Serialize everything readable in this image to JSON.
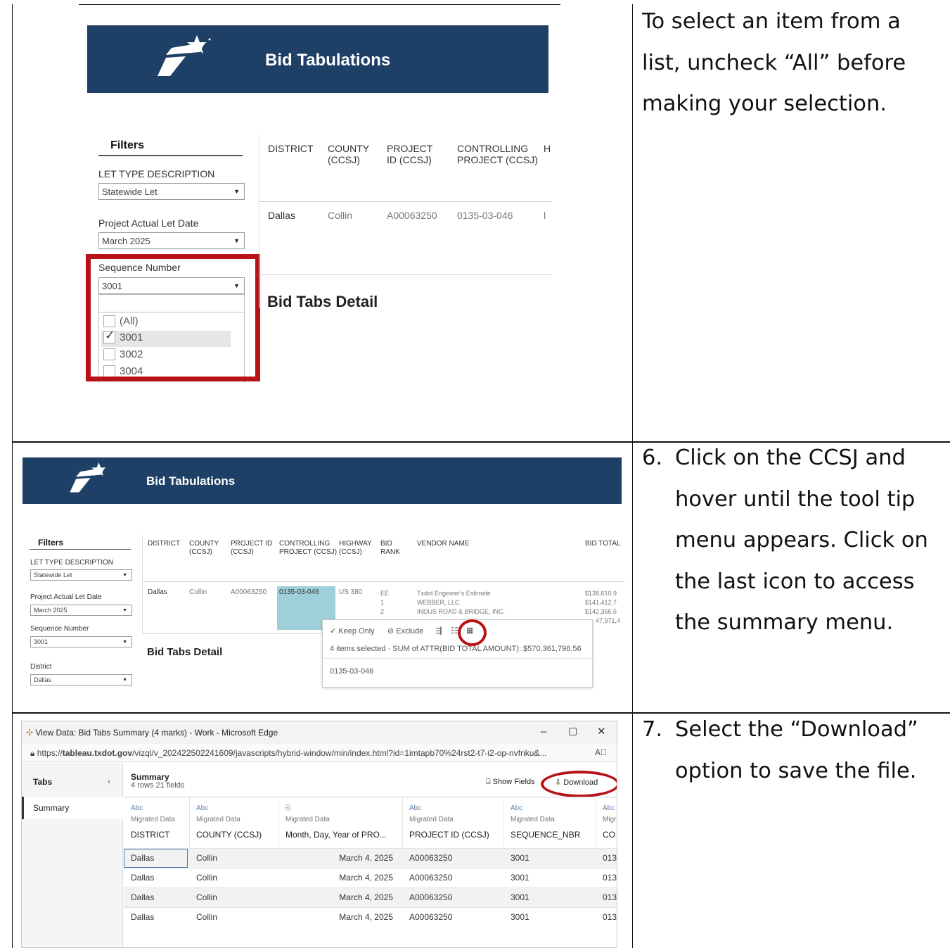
{
  "instructions": {
    "row1": "To select an item from a list, uncheck “All” before making your selection.",
    "row2_number": "6.",
    "row2": "Click on the CCSJ and hover until the tool tip menu appears. Click on the last icon to access the summary menu.",
    "row3_number": "7.",
    "row3": "Select the “Download” option to save the file."
  },
  "shot1": {
    "banner_title": "Bid Tabulations",
    "filters_title": "Filters",
    "let_type_label": "LET TYPE DESCRIPTION",
    "let_type_value": "Statewide Let",
    "let_date_label": "Project Actual Let Date",
    "let_date_value": "March 2025",
    "sequence_label": "Sequence Number",
    "sequence_value": "3001",
    "options": [
      "(All)",
      "3001",
      "3002",
      "3004"
    ],
    "headers": {
      "district": "DISTRICT",
      "county": "COUNTY (CCSJ)",
      "project_id": "PROJECT ID (CCSJ)",
      "controlling": "CONTROLLING PROJECT (CCSJ)"
    },
    "row": {
      "district": "Dallas",
      "county": "Collin",
      "project_id": "A00063250",
      "controlling": "0135-03-046"
    },
    "detail_title": "Bid Tabs Detail"
  },
  "shot2": {
    "banner_title": "Bid Tabulations",
    "filters_title": "Filters",
    "let_type_label": "LET TYPE DESCRIPTION",
    "let_type_value": "Statewide Let",
    "let_date_label": "Project Actual Let Date",
    "let_date_value": "March 2025",
    "sequence_label": "Sequence Number",
    "sequence_value": "3001",
    "district_label": "District",
    "district_value": "Dallas",
    "headers": {
      "district": "DISTRICT",
      "county": "COUNTY (CCSJ)",
      "project_id": "PROJECT ID (CCSJ)",
      "controlling": "CONTROLLING PROJECT (CCSJ)",
      "highway": "HIGHWAY (CCSJ)",
      "bid_rank": "BID RANK",
      "vendor": "VENDOR NAME",
      "bid_total": "BID TOTAL"
    },
    "row": {
      "district": "Dallas",
      "county": "Collin",
      "project_id": "A00063250",
      "controlling": "0135-03-046",
      "highway": "US 380"
    },
    "ranks": [
      "EE",
      "1",
      "2"
    ],
    "vendors": [
      "Txdot Engineer's Estimate",
      "WEBBER, LLC",
      "INDUS ROAD & BRIDGE, INC."
    ],
    "totals": [
      "$138,610,9",
      "$141,412,7",
      "$142,366,6",
      "47,971,4"
    ],
    "detail_title": "Bid Tabs Detail",
    "tooltip": {
      "keep_only": "Keep Only",
      "exclude": "Exclude",
      "selection_text": "4 items selected · SUM of ATTR(BID TOTAL AMOUNT): $570,361,796.56",
      "value": "0135-03-046"
    }
  },
  "shot3": {
    "window_title": "View Data: Bid Tabs Summary (4 marks) - Work - Microsoft Edge",
    "url_prefix": "https://",
    "url_domain": "tableau.txdot.gov",
    "url_rest": "/vizql/v_202422502241609/javascripts/hybrid-window/min/index.html?id=1imtapb70%24rst2-t7-i2-op-nvfnku&...",
    "tabs_label": "Tabs",
    "summary_tab": "Summary",
    "summary_title": "Summary",
    "summary_sub": "4 rows  21 fields",
    "show_fields": "Show Fields",
    "download": "Download",
    "type_labels": [
      "Abc",
      "Abc",
      "",
      "Abc",
      "Abc",
      "Abc"
    ],
    "source_label": "Migrated Data",
    "source_short": "Migr",
    "columns": [
      "DISTRICT",
      "COUNTY (CCSJ)",
      "Month, Day, Year of PRO...",
      "PROJECT ID (CCSJ)",
      "SEQUENCE_NBR",
      "CO"
    ],
    "rows": [
      [
        "Dallas",
        "Collin",
        "March 4, 2025",
        "A00063250",
        "3001",
        "013"
      ],
      [
        "Dallas",
        "Collin",
        "March 4, 2025",
        "A00063250",
        "3001",
        "013"
      ],
      [
        "Dallas",
        "Collin",
        "March 4, 2025",
        "A00063250",
        "3001",
        "013"
      ],
      [
        "Dallas",
        "Collin",
        "March 4, 2025",
        "A00063250",
        "3001",
        "013"
      ]
    ]
  }
}
